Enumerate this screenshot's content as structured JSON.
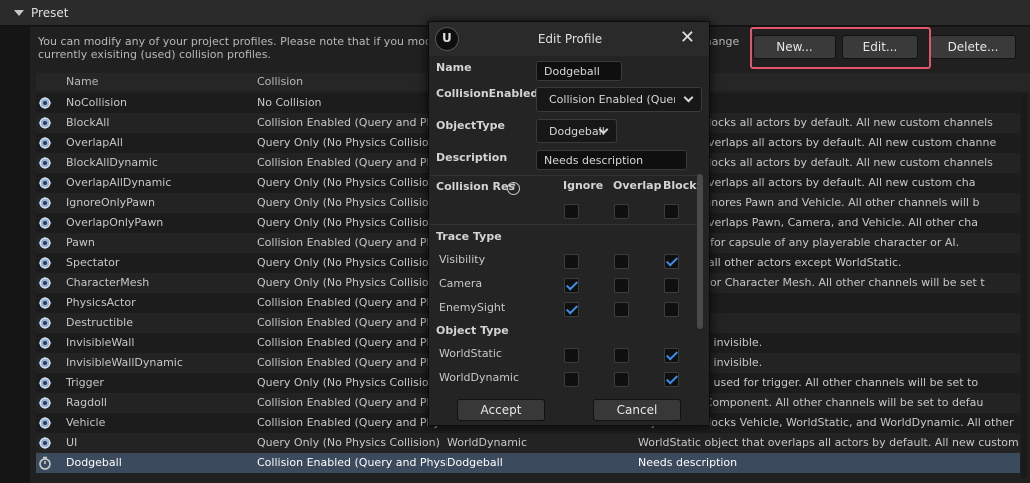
{
  "preset": {
    "title": "Preset"
  },
  "info_text": "You can modify any of your project profiles. Please note that if you modify profile, it can change the behavior when you change currently exisiting (used) collision profiles.",
  "toolbar": {
    "new_label": "New...",
    "edit_label": "Edit...",
    "delete_label": "Delete..."
  },
  "columns": {
    "name": "Name",
    "collision": "Collision"
  },
  "rows": [
    {
      "name": "NoCollision",
      "collision": "No Collision",
      "object": "",
      "desc": ""
    },
    {
      "name": "BlockAll",
      "collision": "Collision Enabled (Query and Physics)",
      "object": "",
      "desc": "object that blocks all actors by default. All new custom channels"
    },
    {
      "name": "OverlapAll",
      "collision": "Query Only (No Physics Collision)",
      "object": "",
      "desc": "object that overlaps all actors by default. All new custom channe"
    },
    {
      "name": "BlockAllDynamic",
      "collision": "Collision Enabled (Query and Physics)",
      "object": "",
      "desc": "object that blocks all actors by default. All new custom channels"
    },
    {
      "name": "OverlapAllDynamic",
      "collision": "Query Only (No Physics Collision)",
      "object": "",
      "desc": "object that overlaps all actors by default. All new custom cha"
    },
    {
      "name": "IgnoreOnlyPawn",
      "collision": "Query Only (No Physics Collision)",
      "object": "",
      "desc": "object that ignores Pawn and Vehicle. All other channels will b"
    },
    {
      "name": "OverlapOnlyPawn",
      "collision": "Query Only (No Physics Collision)",
      "object": "",
      "desc": "object that overlaps Pawn, Camera, and Vehicle. All other cha"
    },
    {
      "name": "Pawn",
      "collision": "Collision Enabled (Query and Physics)",
      "object": "",
      "desc": "Can be used for capsule of any playerable character or AI."
    },
    {
      "name": "Spectator",
      "collision": "Query Only (No Physics Collision)",
      "object": "",
      "desc": "that ignores all other actors except WorldStatic."
    },
    {
      "name": "CharacterMesh",
      "collision": "Query Only (No Physics Collision)",
      "object": "",
      "desc": "that is used for Character Mesh. All other channels will be set t"
    },
    {
      "name": "PhysicsActor",
      "collision": "Collision Enabled (Query and Physics)",
      "object": "",
      "desc": "ctors"
    },
    {
      "name": "Destructible",
      "collision": "Collision Enabled (Query and Physics)",
      "object": "",
      "desc": "actors"
    },
    {
      "name": "InvisibleWall",
      "collision": "Collision Enabled (Query and Physics)",
      "object": "",
      "desc": "object that is invisible."
    },
    {
      "name": "InvisibleWallDynamic",
      "collision": "Collision Enabled (Query and Physics)",
      "object": "",
      "desc": "object that is invisible."
    },
    {
      "name": "Trigger",
      "collision": "Query Only (No Physics Collision)",
      "object": "",
      "desc": "object that is used for trigger. All other channels will be set to"
    },
    {
      "name": "Ragdoll",
      "collision": "Collision Enabled (Query and Physics)",
      "object": "",
      "desc": "eletal Mesh Component. All other channels will be set to defau"
    },
    {
      "name": "Vehicle",
      "collision": "Collision Enabled (Query and Physics)",
      "object": "",
      "desc": "object that blocks Vehicle, WorldStatic, and WorldDynamic. All other"
    },
    {
      "name": "UI",
      "collision": "Query Only (No Physics Collision)",
      "object": "WorldDynamic",
      "desc": "WorldStatic object that overlaps all actors by default. All new custom chann"
    },
    {
      "name": "Dodgeball",
      "collision": "Collision Enabled (Query and Physics)",
      "object": "Dodgeball",
      "desc": "Needs description"
    }
  ],
  "modal": {
    "title": "Edit Profile",
    "name_label": "Name",
    "name_value": "Dodgeball",
    "collision_enabled_label": "CollisionEnabled",
    "collision_enabled_value": "Collision Enabled (Query and Physics)",
    "object_type_label": "ObjectType",
    "object_type_value": "Dodgeball",
    "description_label": "Description",
    "description_value": "Needs description",
    "response_label": "Collision Res",
    "ignore_label": "Ignore",
    "overlap_label": "Overlap",
    "block_label": "Block",
    "trace_type_label": "Trace Type",
    "object_type_section_label": "Object Type",
    "trace_channels": [
      {
        "name": "Visibility",
        "ignore": false,
        "overlap": false,
        "block": true
      },
      {
        "name": "Camera",
        "ignore": true,
        "overlap": false,
        "block": false
      },
      {
        "name": "EnemySight",
        "ignore": true,
        "overlap": false,
        "block": false
      }
    ],
    "object_channels": [
      {
        "name": "WorldStatic",
        "ignore": false,
        "overlap": false,
        "block": true
      },
      {
        "name": "WorldDynamic",
        "ignore": false,
        "overlap": false,
        "block": true
      }
    ],
    "accept_label": "Accept",
    "cancel_label": "Cancel"
  },
  "colors": {
    "highlight": "#e5546b",
    "check": "#3f8fe8",
    "selected_row": "#3c4a5e"
  }
}
